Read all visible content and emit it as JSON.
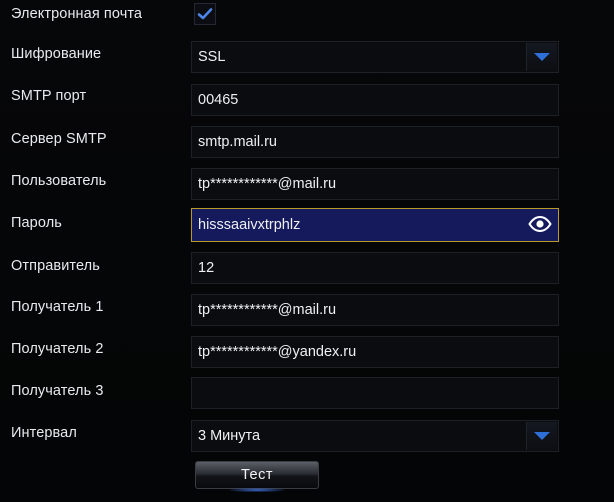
{
  "form": {
    "email_label": "Электронная почта",
    "email_enabled": true,
    "encryption_label": "Шифрование",
    "encryption_value": "SSL",
    "smtp_port_label": "SMTP порт",
    "smtp_port_value": "00465",
    "smtp_server_label": "Сервер SMTP",
    "smtp_server_value": "smtp.mail.ru",
    "user_label": "Пользователь",
    "user_value": "tp************@mail.ru",
    "password_label": "Пароль",
    "password_value": "hisssaaivxtrphlz",
    "sender_label": "Отправитель",
    "sender_value": "12",
    "recipient1_label": "Получатель 1",
    "recipient1_value": "tp************@mail.ru",
    "recipient2_label": "Получатель 2",
    "recipient2_value": "tp************@yandex.ru",
    "recipient3_label": "Получатель 3",
    "recipient3_value": "",
    "interval_label": "Интервал",
    "interval_value": "3 Минута",
    "test_button_label": "Тест"
  },
  "colors": {
    "background": "#030405",
    "field_background": "#0b0c0f",
    "active_field_background": "#141a5c",
    "active_field_border": "#b99b2a",
    "accent_blue": "#2f6fd8"
  },
  "icons": {
    "checkbox": "checkmark-icon",
    "dropdown": "chevron-down-icon",
    "password_toggle": "eye-icon"
  }
}
